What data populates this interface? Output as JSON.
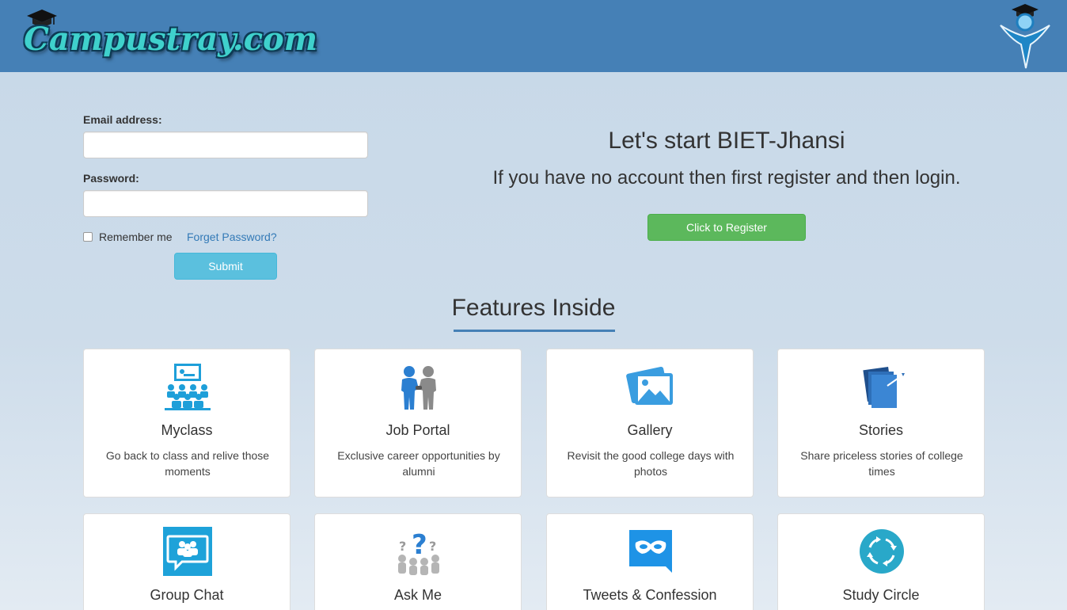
{
  "header": {
    "logo_text": "Campustray.com",
    "brand_color": "#4580b6"
  },
  "login": {
    "email_label": "Email address:",
    "email_value": "",
    "password_label": "Password:",
    "password_value": "",
    "remember_label": "Remember me",
    "remember_checked": false,
    "forgot_label": "Forget Password?",
    "submit_label": "Submit"
  },
  "register": {
    "title": "Let's start BIET-Jhansi",
    "subtitle": "If you have no account then first register and then login.",
    "button_label": "Click to Register"
  },
  "features": {
    "heading": "Features Inside",
    "cards": [
      {
        "title": "Myclass",
        "desc": "Go back to class and relive those moments",
        "icon": "classroom-icon"
      },
      {
        "title": "Job Portal",
        "desc": "Exclusive career opportunities by alumni",
        "icon": "handshake-icon"
      },
      {
        "title": "Gallery",
        "desc": "Revisit the good college days with photos",
        "icon": "photos-icon"
      },
      {
        "title": "Stories",
        "desc": "Share priceless stories of college times",
        "icon": "notes-icon"
      },
      {
        "title": "Group Chat",
        "desc": "",
        "icon": "group-chat-icon"
      },
      {
        "title": "Ask Me",
        "desc": "",
        "icon": "question-people-icon"
      },
      {
        "title": "Tweets & Confession",
        "desc": "",
        "icon": "mask-icon"
      },
      {
        "title": "Study Circle",
        "desc": "",
        "icon": "circle-arrows-icon"
      }
    ]
  },
  "colors": {
    "info_button": "#5bc0de",
    "success_button": "#5cb85c",
    "icon_blue": "#1ea2d9",
    "link": "#337ab7"
  }
}
